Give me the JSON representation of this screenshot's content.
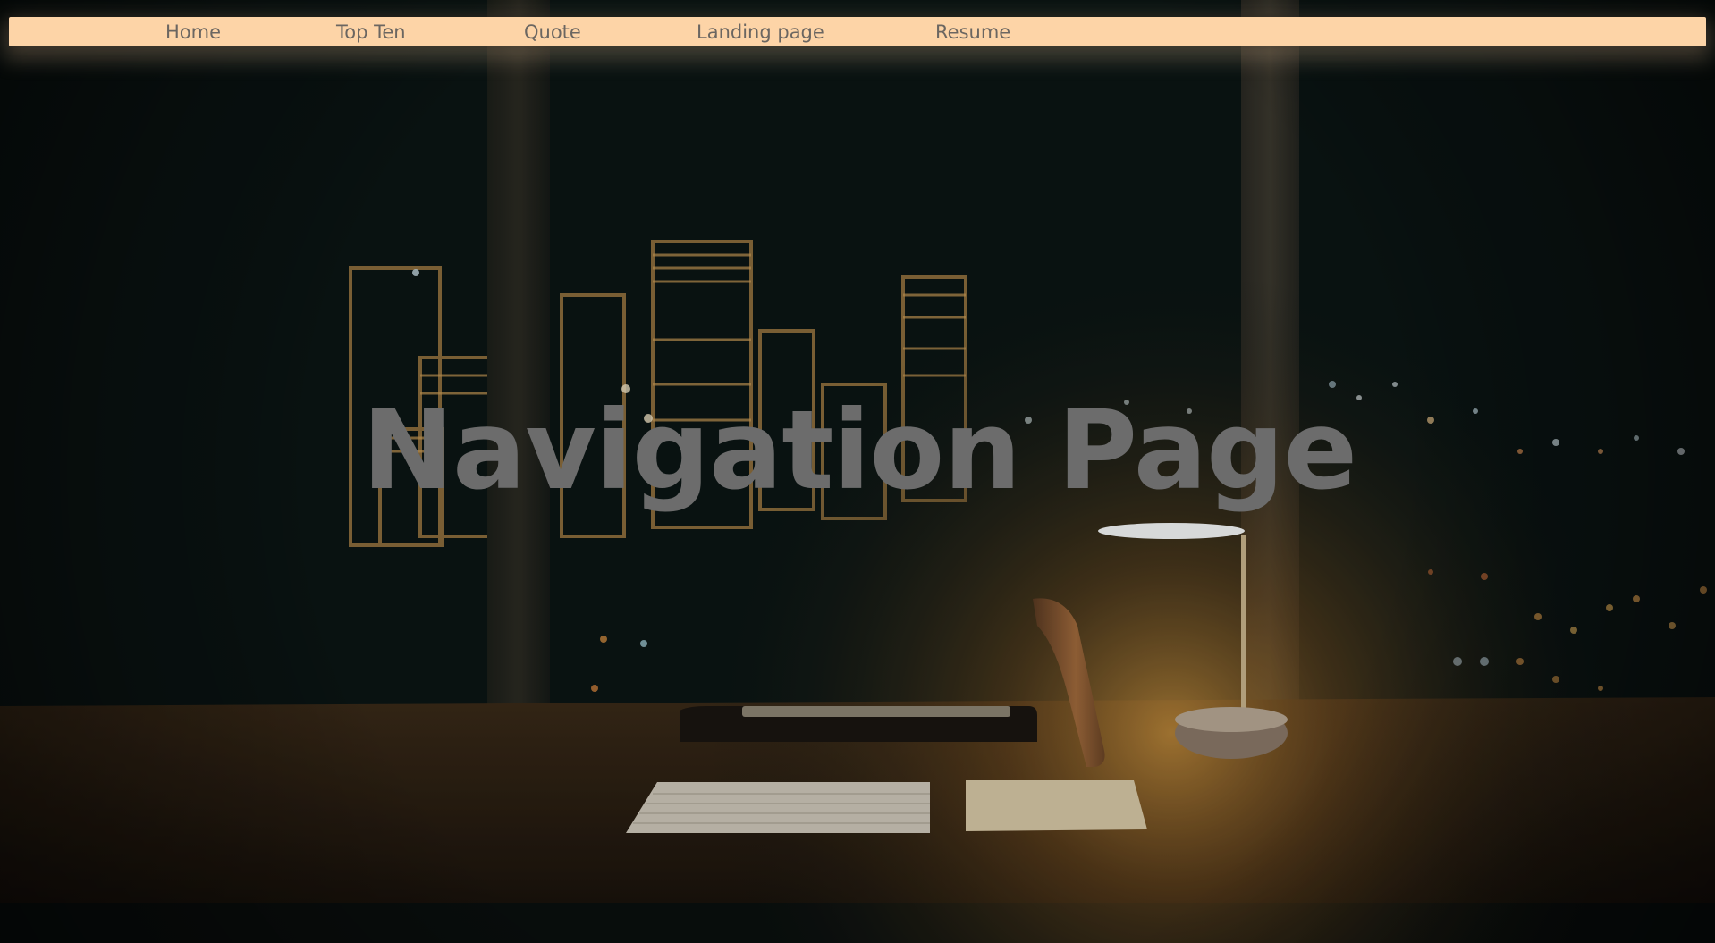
{
  "nav": {
    "items": [
      {
        "label": "Home"
      },
      {
        "label": "Top Ten"
      },
      {
        "label": "Quote"
      },
      {
        "label": "Landing page"
      },
      {
        "label": "Resume"
      }
    ]
  },
  "hero": {
    "title": "Navigation Page"
  },
  "colors": {
    "navbar_bg": "#fdd4a7",
    "nav_text": "#6b6661",
    "title_text": "#6c6c6c",
    "background": "#0b1514"
  },
  "background_image": {
    "subject": "desk-by-night-city-window",
    "contents": [
      "city-lights",
      "desk-lamp",
      "monitor-stand",
      "keyboard",
      "trackpad",
      "wooden-desk"
    ]
  }
}
